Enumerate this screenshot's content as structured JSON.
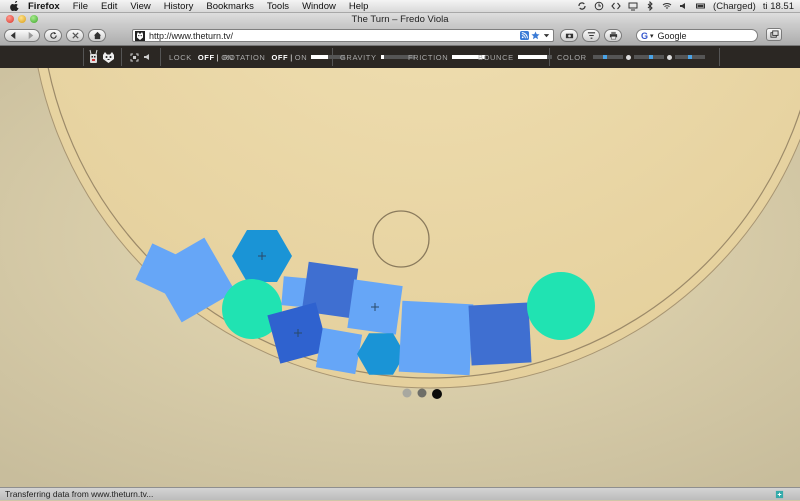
{
  "menubar": {
    "app": "Firefox",
    "items": [
      "File",
      "Edit",
      "View",
      "History",
      "Bookmarks",
      "Tools",
      "Window",
      "Help"
    ],
    "battery": "(Charged)",
    "clock": "ti 18.51"
  },
  "window": {
    "title": "The Turn – Fredo Viola"
  },
  "browser": {
    "url": "http://www.theturn.tv/",
    "search_value": "Google",
    "status_text": "Transferring data from www.theturn.tv..."
  },
  "controls": {
    "lock_label": "LOCK",
    "lock_off": "OFF",
    "lock_on": "ON",
    "rotation_label": "ROTATION",
    "rotation_off": "OFF",
    "rotation_on": "ON",
    "rotation_level": 0.5,
    "gravity_label": "GRAVITY",
    "gravity_level": 0.1,
    "friction_label": "FRICTION",
    "friction_level": 0.95,
    "bounce_label": "BOUNCE",
    "bounce_level": 0.85,
    "color_label": "COLOR",
    "color_levels": [
      0.35,
      0.5,
      0.45
    ],
    "accent_color": "#4aa3e6"
  },
  "icons": {
    "sitebar": [
      "robot-icon",
      "cat-face-icon",
      "fullscreen-icon",
      "speaker-icon"
    ]
  },
  "scene": {
    "colors": {
      "light_blue": "#66a6f7",
      "mid_blue": "#3f6fd1",
      "dark_blue": "#2f62cf",
      "teal_hex": "#1a94d6",
      "mint": "#20e3b2"
    },
    "page_dots": 3,
    "active_page_dot": 3
  }
}
